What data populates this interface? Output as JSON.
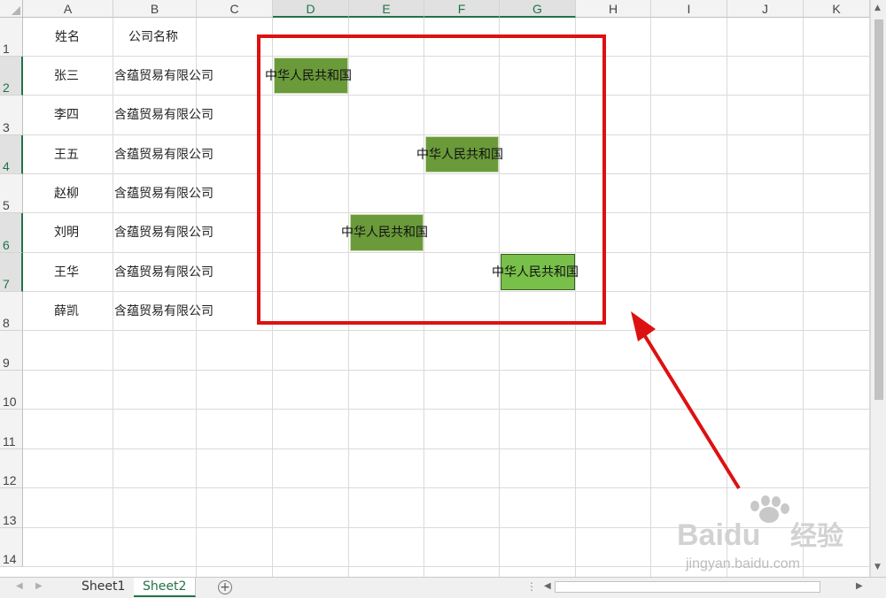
{
  "columns": [
    "A",
    "B",
    "C",
    "D",
    "E",
    "F",
    "G",
    "H",
    "I",
    "J",
    "K"
  ],
  "rows": [
    "1",
    "2",
    "3",
    "4",
    "5",
    "6",
    "7",
    "8",
    "9",
    "10",
    "11",
    "12",
    "13",
    "14"
  ],
  "headers": {
    "name": "姓名",
    "company": "公司名称"
  },
  "records": [
    {
      "name": "张三",
      "company": "含蕴贸易有限公司"
    },
    {
      "name": "李四",
      "company": "含蕴贸易有限公司"
    },
    {
      "name": "王五",
      "company": "含蕴贸易有限公司"
    },
    {
      "name": "赵柳",
      "company": "含蕴贸易有限公司"
    },
    {
      "name": "刘明",
      "company": "含蕴贸易有限公司"
    },
    {
      "name": "王华",
      "company": "含蕴贸易有限公司"
    },
    {
      "name": "薛凯",
      "company": "含蕴贸易有限公司"
    }
  ],
  "highlight_cells": [
    {
      "cell": "D2",
      "text": "中华人民共和国",
      "fill": "#6a9a3a"
    },
    {
      "cell": "F4",
      "text": "中华人民共和国",
      "fill": "#6a9a3a"
    },
    {
      "cell": "E6",
      "text": "中华人民共和国",
      "fill": "#6a9a3a"
    },
    {
      "cell": "G7",
      "text": "中华人民共和国",
      "fill": "#78c04a"
    }
  ],
  "tabs": [
    "Sheet1",
    "Sheet2"
  ],
  "active_tab": "Sheet2",
  "icons": {
    "add_sheet": "plus-circle-icon",
    "scroll_left": "triangle-left-icon",
    "scroll_right": "triangle-right-icon",
    "scroll_up": "triangle-up-icon",
    "scroll_down": "triangle-down-icon"
  },
  "annotation": {
    "box_color": "#dd1111",
    "arrow_color": "#dd1111"
  },
  "watermark": {
    "brand": "Baidu",
    "brand_cn": "经验",
    "url": "jingyan.baidu.com"
  }
}
